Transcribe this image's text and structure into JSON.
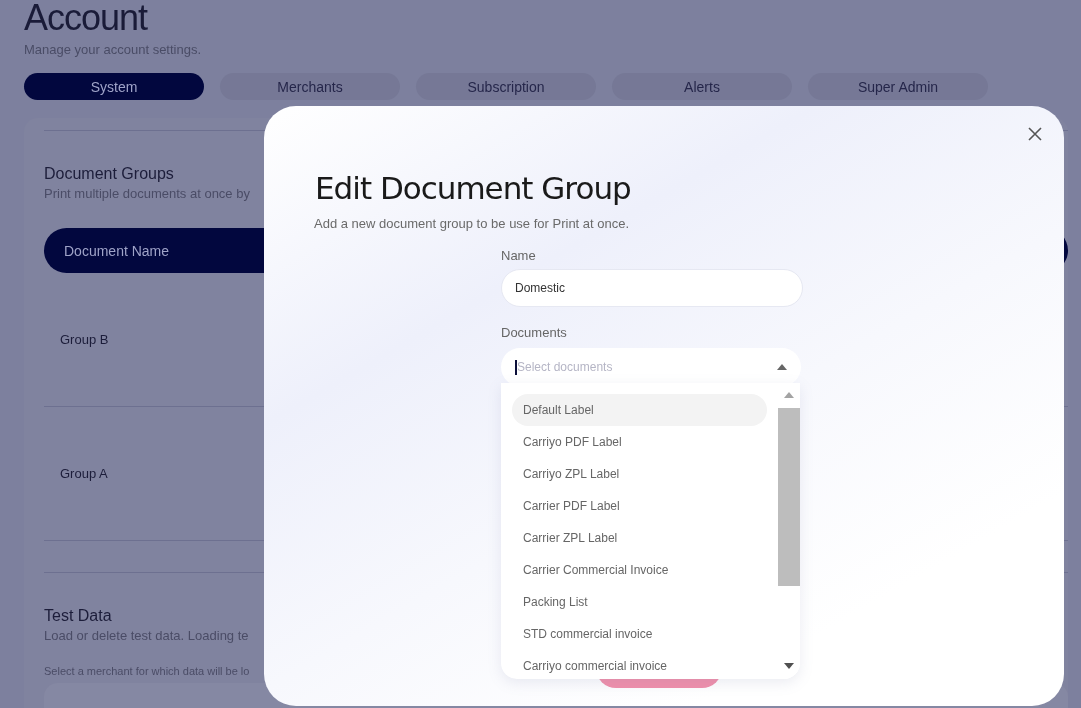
{
  "page": {
    "title": "Account",
    "subtitle": "Manage your account settings.",
    "tabs": [
      {
        "label": "System",
        "selected": true
      },
      {
        "label": "Merchants",
        "selected": false
      },
      {
        "label": "Subscription",
        "selected": false
      },
      {
        "label": "Alerts",
        "selected": false
      },
      {
        "label": "Super Admin",
        "selected": false
      }
    ],
    "document_groups": {
      "title": "Document Groups",
      "subtitle": "Print multiple documents at once by",
      "column_1": "Document Name",
      "rows": [
        "Group B",
        "Group A"
      ]
    },
    "test_data": {
      "title": "Test Data",
      "subtitle": "Load or delete test data. Loading te",
      "hint": "Select a merchant for which data will be lo"
    }
  },
  "modal": {
    "title": "Edit Document Group",
    "subtitle": "Add a new document group to be use for Print at once.",
    "name_field": {
      "label": "Name",
      "value": "Domestic"
    },
    "documents_field": {
      "label": "Documents",
      "placeholder": "Select documents",
      "expanded": true,
      "options": [
        {
          "label": "Default Label",
          "selected": true
        },
        {
          "label": "Carriyo PDF Label",
          "selected": false
        },
        {
          "label": "Carriyo ZPL Label",
          "selected": false
        },
        {
          "label": "Carrier PDF Label",
          "selected": false
        },
        {
          "label": "Carrier ZPL Label",
          "selected": false
        },
        {
          "label": "Carrier Commercial Invoice",
          "selected": false
        },
        {
          "label": "Packing List",
          "selected": false
        },
        {
          "label": "STD commercial invoice",
          "selected": false
        },
        {
          "label": "Carriyo commercial invoice",
          "selected": false
        }
      ]
    }
  }
}
